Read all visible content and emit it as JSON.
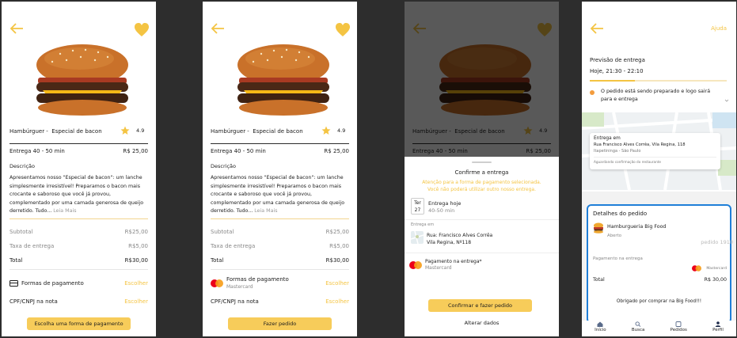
{
  "product": {
    "title_prefix": "Hambúrguer -",
    "title_name": "Especial de bacon",
    "rating": "4.9",
    "delivery_label": "Entrega 40 - 50 min",
    "price": "R$ 25,00",
    "description_header": "Descrição",
    "description": "Apresentamos nosso \"Especial de bacon\": um lanche simplesmente irresistível! Preparamos o bacon mais crocante e saboroso que você já provou, complementado por uma camada generosa de queijo derretido. Tudo...",
    "read_more": "Leia Mais"
  },
  "summary": {
    "subtotal_label": "Subtotal",
    "subtotal_value": "R$25,00",
    "fee_label": "Taxa de entrega",
    "fee_value": "R$5,00",
    "total_label": "Total",
    "total_value": "R$30,00"
  },
  "payment": {
    "label": "Formas de pagamento",
    "method": "Mastercard",
    "choose": "Escolher",
    "cpf_label": "CPF/CNPJ na nota"
  },
  "buttons": {
    "choose_payment": "Escolha uma forma de pagamento",
    "place_order": "Fazer pedido"
  },
  "confirm": {
    "title": "Confirme a entrega",
    "warning_1": "Atenção para a forma de pagamento selecionada.",
    "warning_2": "Você não poderá utilizar outro nosso entrega.",
    "day_abbr": "Ter",
    "day_num": "27",
    "delivery_today": "Entrega hoje",
    "delivery_window": "40-50 min",
    "address_header": "Entrega em",
    "address_line1": "Rua: Francisco Alves Corrêa",
    "address_line2": "Vila Regina, Nº118",
    "pay_label": "Pagamento na entrega*",
    "pay_method": "Mastercard",
    "confirm_button": "Confirmar e fazer pedido",
    "change_link": "Alterar dados"
  },
  "tracking": {
    "help": "Ajuda",
    "forecast_label": "Previsão de entrega",
    "forecast_time": "Hoje, 21:30 - 22:10",
    "progress": 0.33,
    "status_text": "O pedido está sendo preparado e logo sairá para e entrega",
    "map_header": "Entrega em",
    "map_address": "Rua Francisco Alves Corrêa, Vila Regina, 118",
    "map_city": "Itapetininga - São Paulo",
    "map_status": "Aguardando confirmação do restaurante",
    "details_title": "Detalhes do pedido",
    "restaurant": "Hamburgueria Big Food",
    "open_status": "Aberto",
    "order_label": "pedido 1910",
    "pay_label": "Pagamento na entrega",
    "pay_method": "Mastercard",
    "total_label": "Total",
    "total_value": "R$ 30,00",
    "thanks": "Obrigado por comprar na Big Food!!!",
    "nav": [
      "Início",
      "Busca",
      "Pedidos",
      "Perfil"
    ]
  },
  "colors": {
    "accent": "#f4c443",
    "button": "#f7cc5a",
    "orange": "#f39c3d",
    "highlight_border": "#1f7fd8"
  }
}
